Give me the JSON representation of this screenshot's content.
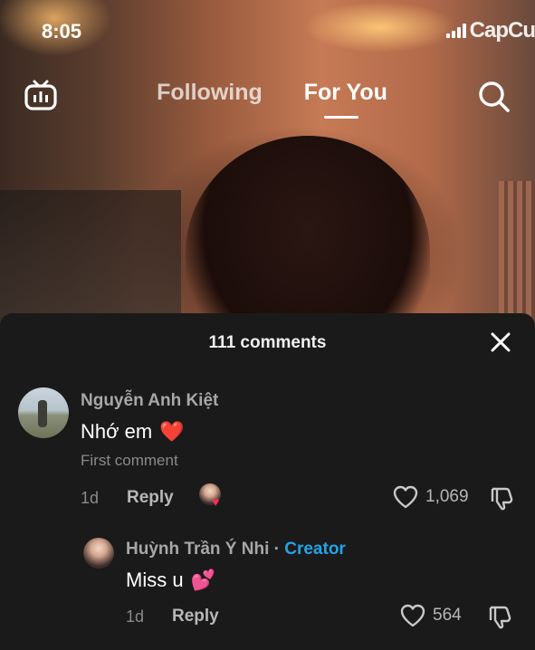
{
  "status_bar": {
    "time": "8:05",
    "watermark": "CapCu"
  },
  "nav": {
    "tabs": [
      {
        "label": "Following",
        "active": false
      },
      {
        "label": "For You",
        "active": true
      }
    ],
    "left_icon": "live-tv-icon",
    "right_icon": "search-icon"
  },
  "comments_sheet": {
    "title": "111 comments",
    "close_icon": "close-icon",
    "comments": [
      {
        "username": "Nguyễn Anh Kiệt",
        "text": "Nhớ em",
        "emoji": "❤️",
        "tag": "First comment",
        "age": "1d",
        "reply_label": "Reply",
        "liked_by_creator": true,
        "likes": "1,069"
      },
      {
        "username": "Huỳnh Trần Ý Nhi",
        "separator": "·",
        "badge": "Creator",
        "text": "Miss u",
        "emoji": "💕",
        "age": "1d",
        "reply_label": "Reply",
        "likes": "564"
      }
    ]
  },
  "colors": {
    "sheet_bg": "#1a1a1a",
    "creator_badge": "#25a3e6",
    "like_accent": "#fe2c55"
  }
}
